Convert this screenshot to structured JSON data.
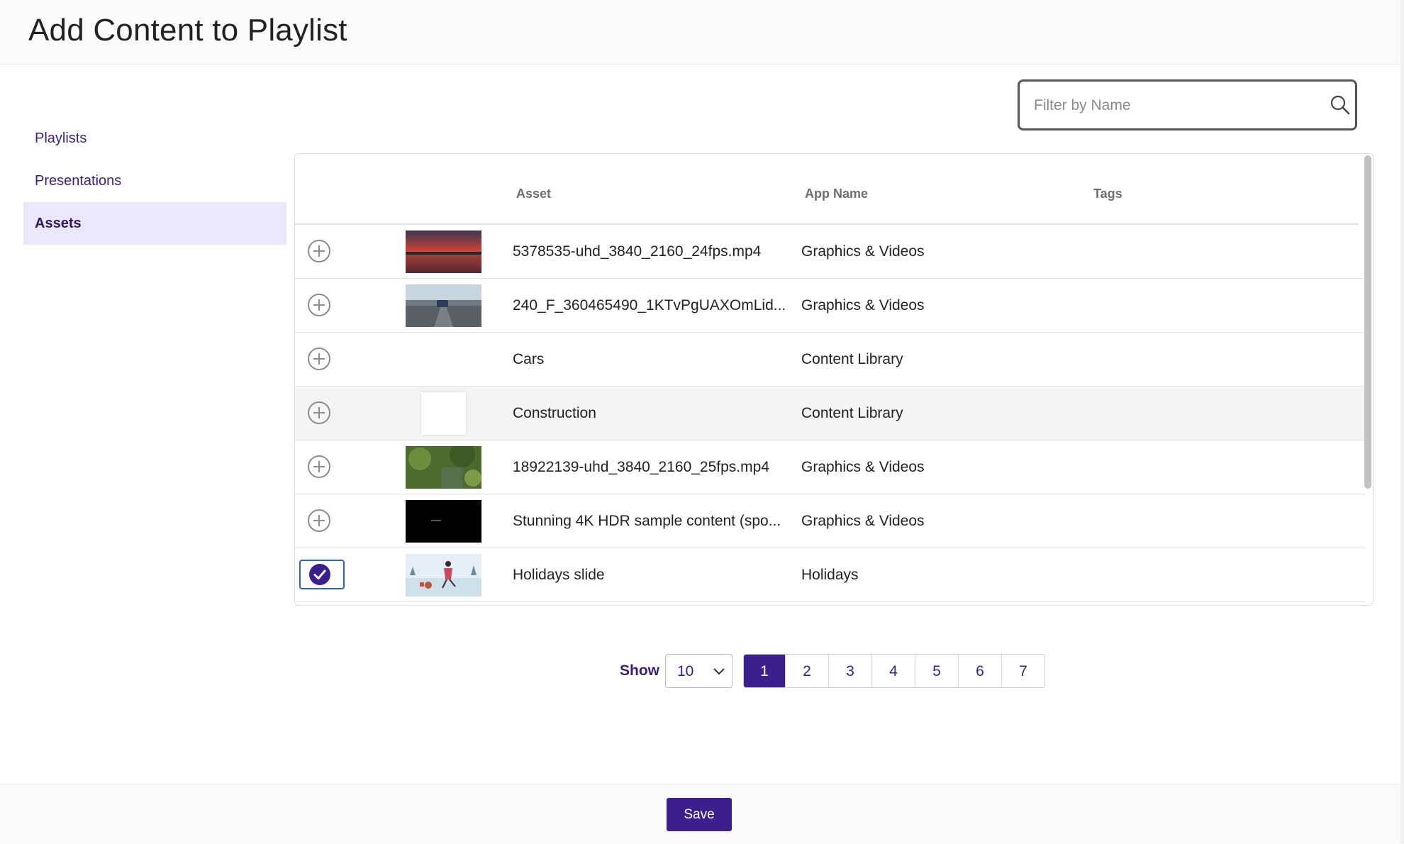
{
  "page": {
    "title": "Add Content to Playlist"
  },
  "sidebar": {
    "items": [
      {
        "label": "Playlists",
        "active": false
      },
      {
        "label": "Presentations",
        "active": false
      },
      {
        "label": "Assets",
        "active": true
      }
    ]
  },
  "filter": {
    "placeholder": "Filter by Name",
    "icon": "search-icon"
  },
  "table": {
    "columns": [
      "",
      "",
      "Asset",
      "App Name",
      "Tags"
    ],
    "rows": [
      {
        "asset": "5378535-uhd_3840_2160_24fps.mp4",
        "app": "Graphics & Videos",
        "tags": "",
        "selected": false,
        "thumbnail": "sunset-lake"
      },
      {
        "asset": "240_F_360465490_1KTvPgUAXOmLid...",
        "app": "Graphics & Videos",
        "tags": "",
        "selected": false,
        "thumbnail": "road-car"
      },
      {
        "asset": "Cars",
        "app": "Content Library",
        "tags": "",
        "selected": false,
        "thumbnail": "none"
      },
      {
        "asset": "Construction",
        "app": "Content Library",
        "tags": "",
        "selected": false,
        "thumbnail": "blank"
      },
      {
        "asset": "18922139-uhd_3840_2160_25fps.mp4",
        "app": "Graphics & Videos",
        "tags": "",
        "selected": false,
        "thumbnail": "forest"
      },
      {
        "asset": "Stunning 4K HDR sample content (spo...",
        "app": "Graphics & Videos",
        "tags": "",
        "selected": false,
        "thumbnail": "black"
      },
      {
        "asset": "Holidays slide",
        "app": "Holidays",
        "tags": "",
        "selected": true,
        "thumbnail": "holiday-skater"
      }
    ]
  },
  "pagination": {
    "show_label": "Show",
    "page_size": "10",
    "pages": [
      "1",
      "2",
      "3",
      "4",
      "5",
      "6",
      "7"
    ],
    "current": "1"
  },
  "footer": {
    "save_label": "Save"
  },
  "colors": {
    "accent": "#3b1f8c",
    "sidebar_active_bg": "#ebe7fb",
    "link": "#3d1f7a"
  }
}
